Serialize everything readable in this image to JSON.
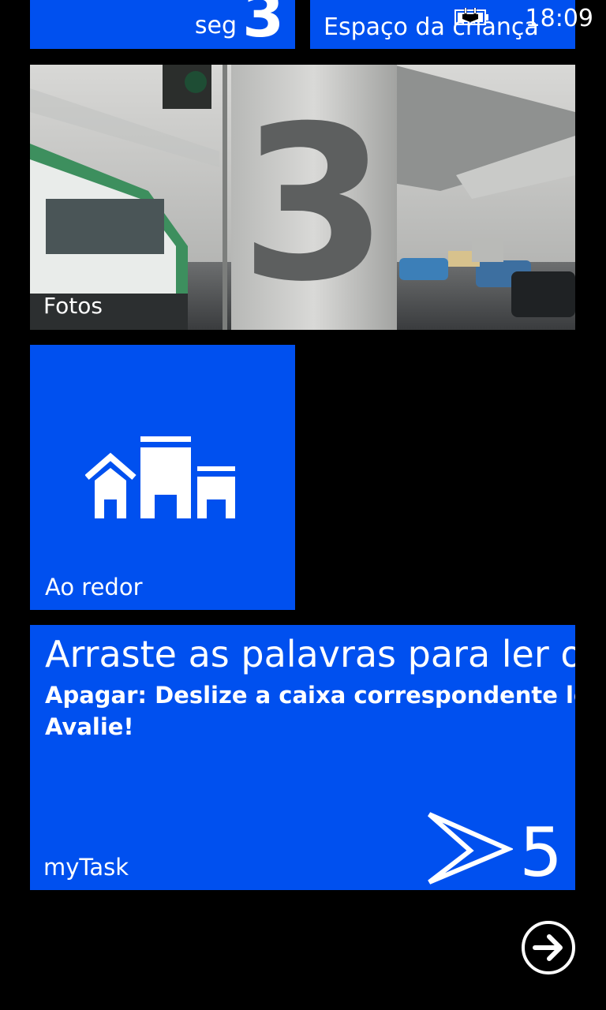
{
  "status_bar": {
    "time": "18:09",
    "battery_icon": "battery-charging-icon"
  },
  "tiles": {
    "calendar": {
      "day_label": "seg",
      "day_number": "3"
    },
    "kids_corner": {
      "label": "Espaço da criança"
    },
    "photos": {
      "label": "Fotos"
    },
    "nearby": {
      "label": "Ao redor",
      "icon": "buildings-icon"
    },
    "mytask": {
      "line1": "Arraste as palavras para ler o r",
      "line2": "Apagar: Deslize a caixa correspondente longe p",
      "line3": "Avalie!",
      "label": "myTask",
      "count": "5",
      "logo_icon": "mytask-logo-icon"
    }
  },
  "navigation": {
    "arrow_icon": "arrow-right-circle-icon"
  },
  "colors": {
    "accent": "#0050ef",
    "background": "#000000"
  }
}
